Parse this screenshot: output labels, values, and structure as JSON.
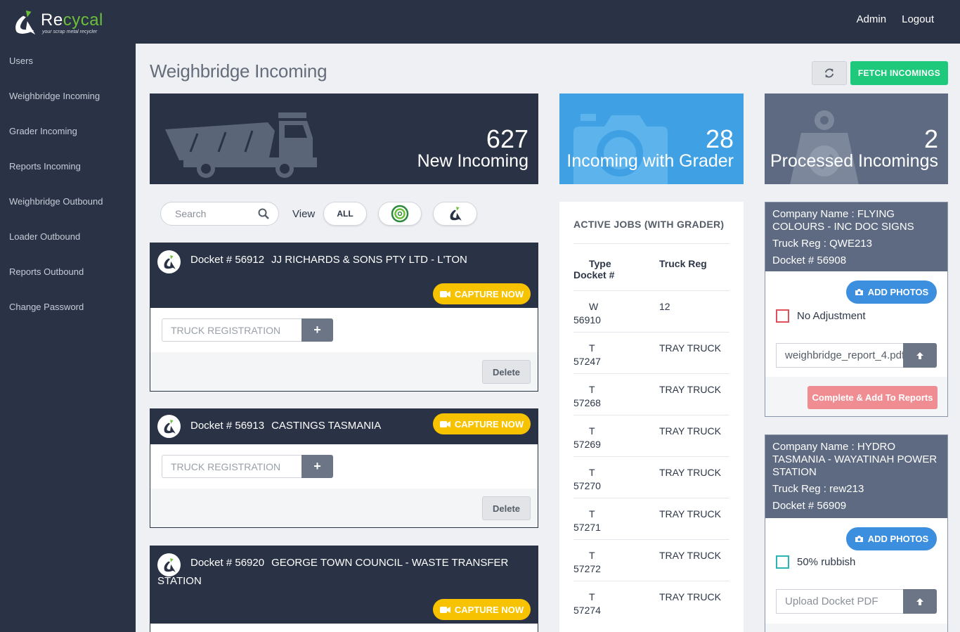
{
  "app": {
    "logo_title_prefix": "Re",
    "logo_title_accent": "cycal",
    "logo_subtitle": "your scrap metal recycler"
  },
  "topnav": {
    "admin": "Admin",
    "logout": "Logout"
  },
  "sidebar": {
    "items": [
      {
        "label": "Users"
      },
      {
        "label": "Weighbridge Incoming"
      },
      {
        "label": "Grader Incoming"
      },
      {
        "label": "Reports Incoming"
      },
      {
        "label": "Weighbridge Outbound"
      },
      {
        "label": "Loader Outbound"
      },
      {
        "label": "Reports Outbound"
      },
      {
        "label": "Change Password"
      }
    ]
  },
  "page": {
    "title": "Weighbridge Incoming",
    "fetch_label": "FETCH INCOMINGS",
    "refresh_icon": "refresh-icon"
  },
  "stats": [
    {
      "value": "627",
      "label": "New Incoming",
      "icon": "truck-icon",
      "color": "#2a3345"
    },
    {
      "value": "28",
      "label": "Incoming with Grader",
      "icon": "camera-icon",
      "color": "#3fa1e4"
    },
    {
      "value": "2",
      "label": "Processed Incomings",
      "icon": "weight-icon",
      "color": "#5d6a81"
    }
  ],
  "filters": {
    "search_placeholder": "Search",
    "view_label": "View",
    "all_label": "ALL"
  },
  "dockets": [
    {
      "docket": "Docket # 56912",
      "company": "JJ RICHARDS & SONS PTY LTD - L'TON",
      "capture": "CAPTURE NOW",
      "truck_placeholder": "TRUCK REGISTRATION",
      "delete": "Delete"
    },
    {
      "docket": "Docket # 56913",
      "company": "CASTINGS TASMANIA",
      "capture": "CAPTURE NOW",
      "truck_placeholder": "TRUCK REGISTRATION",
      "delete": "Delete"
    },
    {
      "docket": "Docket # 56920",
      "company": "GEORGE TOWN COUNCIL - WASTE TRANSFER STATION",
      "capture": "CAPTURE NOW"
    }
  ],
  "active_jobs": {
    "title": "ACTIVE JOBS (WITH GRADER)",
    "col_type": "Type",
    "col_docket": "Docket #",
    "col_truck": "Truck Reg",
    "rows": [
      {
        "type": "W",
        "docket": "56910",
        "truck": "12"
      },
      {
        "type": "T",
        "docket": "57247",
        "truck": "TRAY TRUCK"
      },
      {
        "type": "T",
        "docket": "57268",
        "truck": "TRAY TRUCK"
      },
      {
        "type": "T",
        "docket": "57269",
        "truck": "TRAY TRUCK"
      },
      {
        "type": "T",
        "docket": "57270",
        "truck": "TRAY TRUCK"
      },
      {
        "type": "T",
        "docket": "57271",
        "truck": "TRAY TRUCK"
      },
      {
        "type": "T",
        "docket": "57272",
        "truck": "TRAY TRUCK"
      },
      {
        "type": "T",
        "docket": "57274",
        "truck": "TRAY TRUCK"
      }
    ]
  },
  "processed": [
    {
      "company": "Company Name : FLYING COLOURS - INC DOC SIGNS",
      "truck": "Truck Reg : QWE213",
      "docket": "Docket # 56908",
      "add_photos": "ADD PHOTOS",
      "check_label": "No Adjustment",
      "check_color": "#e0505a",
      "file_value": "weighbridge_report_4.pdf",
      "complete": "Complete & Add To Reports"
    },
    {
      "company": "Company Name : HYDRO TASMANIA - WAYATINAH POWER STATION",
      "truck": "Truck Reg : rew213",
      "docket": "Docket # 56909",
      "add_photos": "ADD PHOTOS",
      "check_label": "50% rubbish",
      "check_color": "#2bb5b5",
      "file_placeholder": "Upload Docket PDF"
    }
  ]
}
